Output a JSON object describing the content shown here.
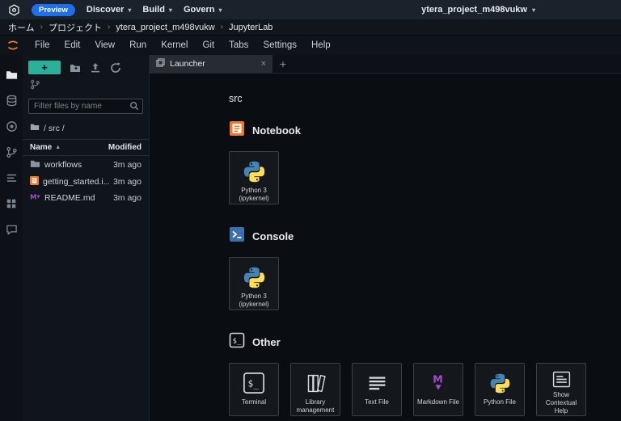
{
  "colors": {
    "accent_teal": "#2bb19a",
    "preview_blue": "#1f6feb",
    "notebook_orange": "#f37726",
    "console_blue": "#3a70b0",
    "markdown_purple": "#a64ccf",
    "python_blue": "#4584b6",
    "python_yellow": "#ffde57"
  },
  "icons": {
    "chevron_down": "▾",
    "sort_ascending": "▲",
    "close": "×"
  },
  "topbar": {
    "preview_badge": "Preview",
    "menus": [
      {
        "label": "Discover"
      },
      {
        "label": "Build"
      },
      {
        "label": "Govern"
      }
    ],
    "project_selector": "ytera_project_m498vukw"
  },
  "breadcrumb": {
    "separator": "›",
    "items": [
      "ホーム",
      "プロジェクト",
      "ytera_project_m498vukw",
      "JupyterLab"
    ]
  },
  "jupyter_menu": {
    "items": [
      "File",
      "Edit",
      "View",
      "Run",
      "Kernel",
      "Git",
      "Tabs",
      "Settings",
      "Help"
    ]
  },
  "file_browser": {
    "new_button_label": "+",
    "filter_placeholder": "Filter files by name",
    "path": "/ src /",
    "columns": {
      "name": "Name",
      "modified": "Modified"
    },
    "files": [
      {
        "name": "workflows",
        "modified": "3m ago",
        "icon": "folder-icon"
      },
      {
        "name": "getting_started.i...",
        "modified": "3m ago",
        "icon": "notebook-file-icon"
      },
      {
        "name": "README.md",
        "modified": "3m ago",
        "icon": "markdown-file-icon"
      }
    ]
  },
  "tabbar": {
    "active_tab": "Launcher",
    "new_tab_label": "+"
  },
  "launcher": {
    "current_directory": "src",
    "sections": [
      {
        "title": "Notebook",
        "icon": "notebook-section-icon",
        "cards": [
          {
            "label": "Python 3 (ipykernel)",
            "icon": "python-logo-icon"
          }
        ]
      },
      {
        "title": "Console",
        "icon": "console-section-icon",
        "cards": [
          {
            "label": "Python 3 (ipykernel)",
            "icon": "python-logo-icon"
          }
        ]
      },
      {
        "title": "Other",
        "icon": "terminal-section-icon",
        "cards": [
          {
            "label": "Terminal",
            "icon": "terminal-icon"
          },
          {
            "label": "Library management",
            "icon": "library-icon"
          },
          {
            "label": "Text File",
            "icon": "text-file-icon"
          },
          {
            "label": "Markdown File",
            "icon": "markdown-icon"
          },
          {
            "label": "Python File",
            "icon": "python-logo-icon"
          },
          {
            "label": "Show Contextual Help",
            "icon": "contextual-help-icon"
          }
        ]
      }
    ]
  }
}
